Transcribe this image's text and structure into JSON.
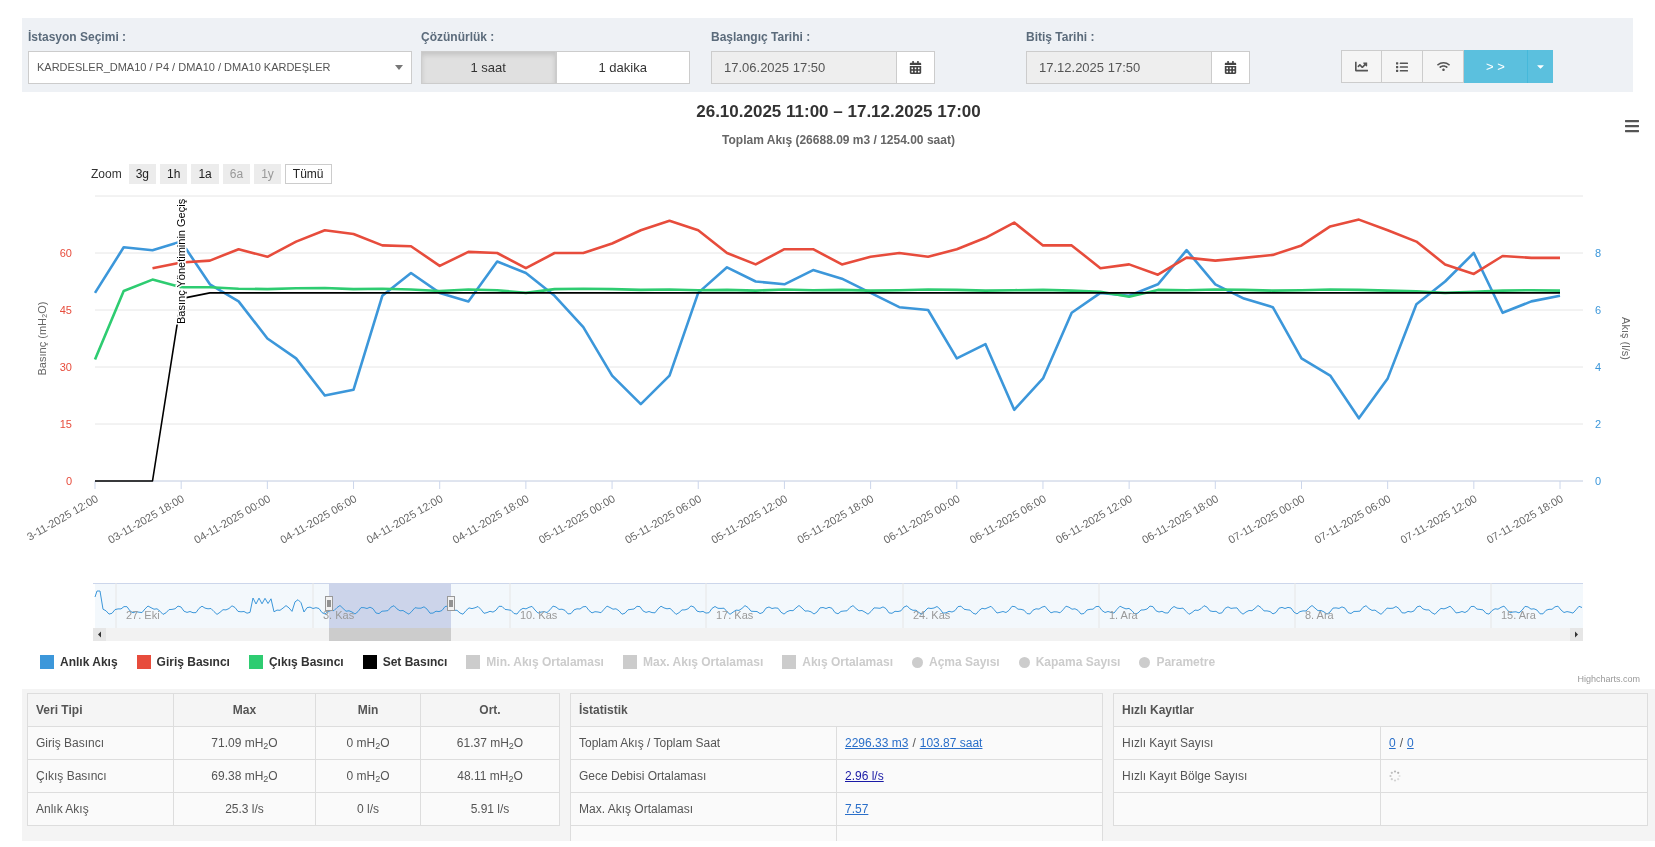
{
  "filters": {
    "station": {
      "label": "İstasyon Seçimi :",
      "value": "KARDESLER_DMA10 / P4 / DMA10 / DMA10 KARDEŞLER"
    },
    "resolution": {
      "label": "Çözünürlük :",
      "options": [
        {
          "label": "1 saat",
          "selected": true
        },
        {
          "label": "1 dakika",
          "selected": false
        }
      ]
    },
    "start": {
      "label": "Başlangıç Tarihi :",
      "value": "17.06.2025 17:50"
    },
    "end": {
      "label": "Bitiş Tarihi :",
      "value": "17.12.2025 17:50"
    },
    "actions": [
      {
        "kind": "chart"
      },
      {
        "kind": "list"
      },
      {
        "kind": "wifi"
      },
      {
        "kind": "go",
        "label": "> >"
      }
    ]
  },
  "chart": {
    "title": "26.10.2025 11:00 – 17.12.2025 17:00",
    "subtitle": "Toplam Akış (26688.09 m3 / 1254.00 saat)",
    "zoom": {
      "label": "Zoom",
      "buttons": [
        {
          "label": "3g",
          "selected": false,
          "disabled": false
        },
        {
          "label": "1h",
          "selected": false,
          "disabled": false
        },
        {
          "label": "1a",
          "selected": false,
          "disabled": false
        },
        {
          "label": "6a",
          "selected": false,
          "disabled": true
        },
        {
          "label": "1y",
          "selected": false,
          "disabled": true
        },
        {
          "label": "Tümü",
          "selected": true,
          "disabled": false
        }
      ]
    },
    "chart_data": {
      "type": "line",
      "grid": true,
      "ylabel": "Basınç (mH₂O)",
      "y2label": "Akış (l/s)",
      "ylim": [
        0,
        75
      ],
      "y2lim": [
        0,
        10
      ],
      "yticks": [
        0,
        15,
        30,
        45,
        60
      ],
      "y2ticks": [
        0,
        2,
        4,
        6,
        8
      ],
      "categories": [
        "3-11-2025 12:00",
        null,
        null,
        "03-11-2025 18:00",
        null,
        null,
        "04-11-2025 00:00",
        null,
        null,
        "04-11-2025 06:00",
        null,
        null,
        "04-11-2025 12:00",
        null,
        null,
        "04-11-2025 18:00",
        null,
        null,
        "05-11-2025 00:00",
        null,
        null,
        "05-11-2025 06:00",
        null,
        null,
        "05-11-2025 12:00",
        null,
        null,
        "05-11-2025 18:00",
        null,
        null,
        "06-11-2025 00:00",
        null,
        null,
        "06-11-2025 06:00",
        null,
        null,
        "06-11-2025 12:00",
        null,
        null,
        "06-11-2025 18:00",
        null,
        null,
        "07-11-2025 00:00",
        null,
        null,
        "07-11-2025 06:00",
        null,
        null,
        "07-11-2025 12:00",
        null,
        null,
        "07-11-2025 18:00"
      ],
      "series": [
        {
          "name": "Anlık Akış",
          "color": "#3c97da",
          "axis": "y2",
          "values": [
            6.6,
            8.2,
            8.1,
            8.4,
            6.9,
            6.3,
            5.0,
            4.3,
            3.0,
            3.2,
            6.5,
            7.3,
            6.6,
            6.3,
            7.7,
            7.3,
            6.5,
            5.4,
            3.7,
            2.7,
            3.7,
            6.6,
            7.5,
            7.0,
            6.9,
            7.4,
            7.1,
            6.6,
            6.1,
            6.0,
            4.3,
            4.8,
            2.5,
            3.6,
            5.9,
            6.6,
            6.5,
            6.9,
            8.1,
            6.9,
            6.4,
            6.1,
            4.3,
            3.7,
            2.2,
            3.6,
            6.2,
            7.0,
            8.0,
            5.9,
            6.3,
            6.5
          ]
        },
        {
          "name": "Giriş Basıncı",
          "color": "#e74c3c",
          "values": [
            null,
            null,
            56,
            57.5,
            58,
            61,
            59,
            63,
            66,
            65,
            62,
            61.8,
            56.6,
            60.3,
            60,
            56,
            60,
            60,
            62.5,
            66,
            68.5,
            66,
            60,
            57,
            61,
            61,
            57,
            59,
            60,
            59,
            61,
            64,
            68,
            62,
            62,
            56,
            57,
            54.3,
            58.8,
            58,
            58.7,
            59.5,
            62,
            67,
            68.8,
            66,
            63,
            57,
            54.5,
            59.2,
            58.7,
            58.7
          ]
        },
        {
          "name": "Çıkış Basıncı",
          "color": "#2ecc71",
          "values": [
            32,
            50,
            53,
            51,
            51,
            50.6,
            50.5,
            50.7,
            50.8,
            50.5,
            50.6,
            50.4,
            50,
            50.4,
            50.2,
            49.5,
            50.5,
            50.6,
            50.5,
            50.3,
            50.4,
            50.2,
            50.3,
            50.1,
            50.4,
            50.2,
            50.3,
            50.1,
            50.2,
            50.4,
            50.3,
            50.1,
            50.2,
            50.3,
            50.1,
            49.8,
            48.5,
            50.3,
            50.2,
            50.4,
            50.3,
            50.1,
            50.2,
            50.4,
            50.3,
            50.1,
            49.9,
            49.5,
            49.8,
            50.1,
            50.2,
            50.1
          ]
        },
        {
          "name": "Set Basıncı",
          "color": "#000000",
          "values": [
            0,
            0,
            0,
            48,
            49.5,
            49.5,
            49.5,
            49.5,
            49.5,
            49.5,
            49.5,
            49.5,
            49.5,
            49.5,
            49.5,
            49.5,
            49.5,
            49.5,
            49.5,
            49.5,
            49.5,
            49.5,
            49.5,
            49.5,
            49.5,
            49.5,
            49.5,
            49.5,
            49.5,
            49.5,
            49.5,
            49.5,
            49.5,
            49.5,
            49.5,
            49.5,
            49.5,
            49.5,
            49.5,
            49.5,
            49.5,
            49.5,
            49.5,
            49.5,
            49.5,
            49.5,
            49.5,
            49.5,
            49.5,
            49.5,
            49.5,
            49.5
          ]
        }
      ],
      "annotations": [
        "Basınç Yönetiminin Geçiş"
      ]
    },
    "navigator": {
      "labels": [
        "27. Eki",
        "3. Kas",
        "10. Kas",
        "17. Kas",
        "24. Kas",
        "1. Ara",
        "8. Ara",
        "15. Ara"
      ]
    },
    "legend_hidden": [
      {
        "label": "Min. Akış Ortalaması",
        "kind": "square",
        "visible": false
      },
      {
        "label": "Max. Akış Ortalaması",
        "kind": "square",
        "visible": false
      },
      {
        "label": "Akış Ortalaması",
        "kind": "square",
        "visible": false
      },
      {
        "label": "Açma Sayısı",
        "kind": "circle",
        "visible": false
      },
      {
        "label": "Kapama Sayısı",
        "kind": "circle",
        "visible": false
      },
      {
        "label": "Parametre",
        "kind": "circle",
        "visible": false
      }
    ],
    "credit": "Highcharts.com"
  },
  "data_table": {
    "columns": [
      "Veri Tipi",
      "Max",
      "Min",
      "Ort."
    ],
    "rows": [
      [
        "Giriş Basıncı",
        "71.09 mH$_{2}$O",
        "0 mH$_{2}$O",
        "61.37 mH$_{2}$O"
      ],
      [
        "Çıkış Basıncı",
        "69.38 mH$_{2}$O",
        "0 mH$_{2}$O",
        "48.11 mH$_{2}$O"
      ],
      [
        "Anlık Akış",
        "25.3 l/s",
        "0 l/s",
        "5.91 l/s"
      ]
    ]
  },
  "statistics": {
    "title": "İstatistik",
    "rows": [
      {
        "label": "Toplam Akış / Toplam Saat",
        "value": [
          {
            "kind": "link",
            "text": "2296.33 m3",
            "visited": false
          },
          {
            "kind": "text",
            "text": "/"
          },
          {
            "kind": "link",
            "text": "103.87 saat",
            "visited": false
          }
        ]
      },
      {
        "label": "Gece Debisi Ortalaması",
        "value": [
          {
            "kind": "link",
            "text": "2.96 l/s",
            "visited": true
          }
        ]
      },
      {
        "label": "Max. Akış Ortalaması",
        "value": [
          {
            "kind": "link",
            "text": "7.57",
            "visited": false
          }
        ]
      }
    ]
  },
  "fast_records": {
    "title": "Hızlı Kayıtlar",
    "rows": [
      {
        "label": "Hızlı Kayıt Sayısı",
        "value": [
          {
            "kind": "link",
            "text": "0",
            "visited": false
          },
          {
            "kind": "text",
            "text": "/"
          },
          {
            "kind": "link",
            "text": "0",
            "visited": false
          }
        ]
      },
      {
        "label": "Hızlı Kayıt Bölge Sayısı",
        "value": [
          {
            "kind": "spinner"
          }
        ]
      }
    ]
  }
}
